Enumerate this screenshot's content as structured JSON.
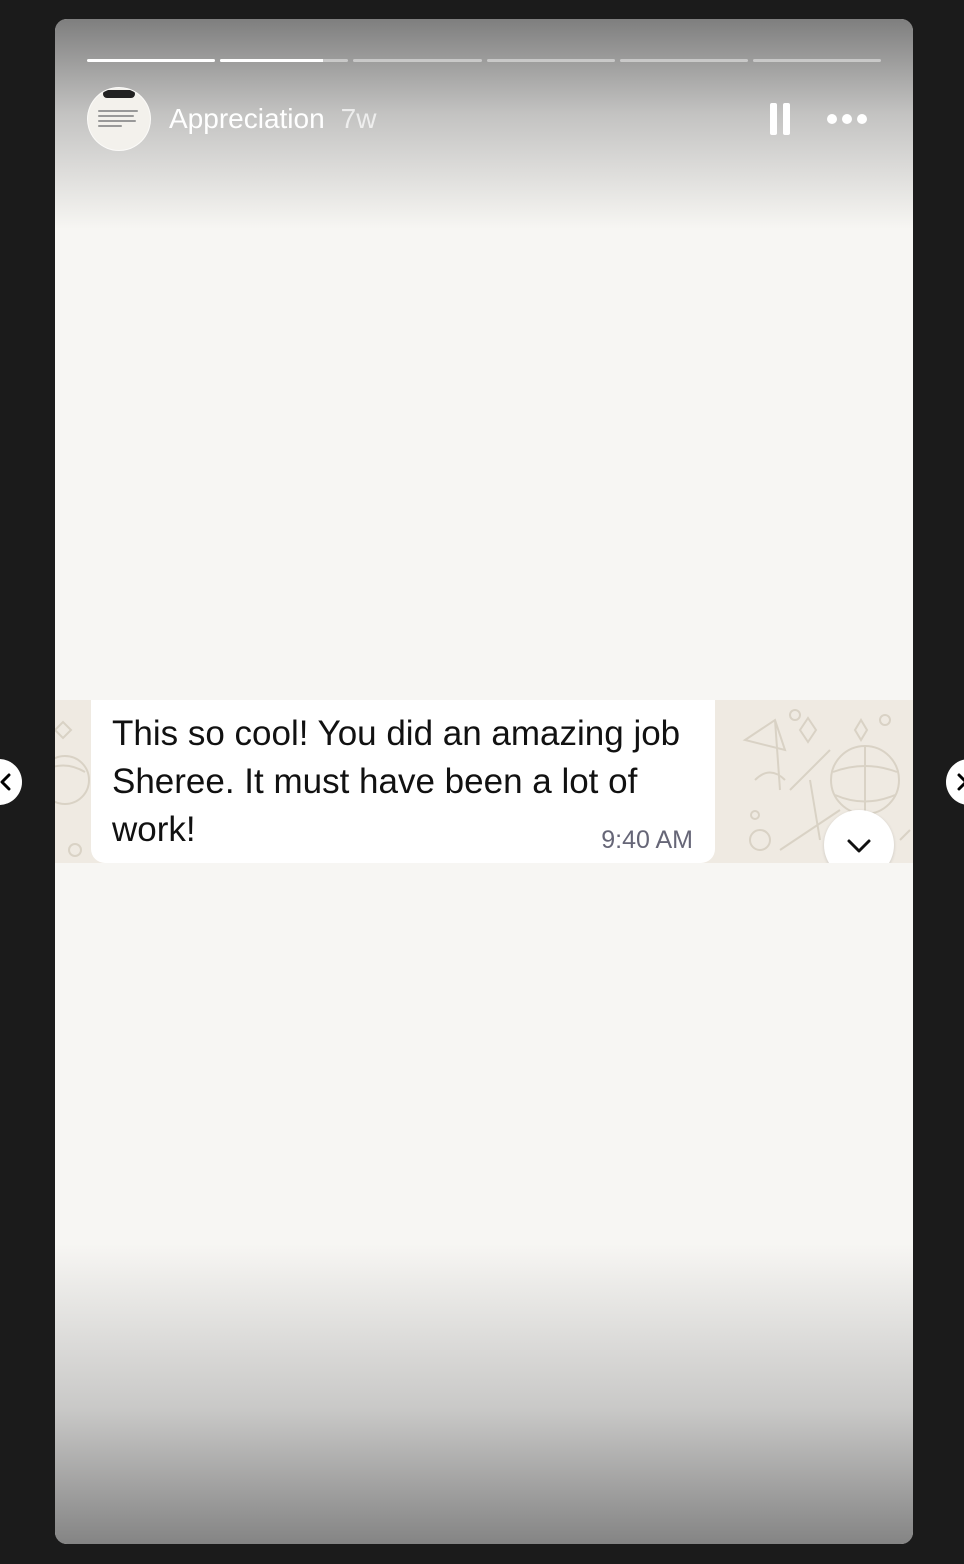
{
  "story": {
    "account_name": "Appreciation",
    "time_ago": "7w",
    "segments": [
      {
        "progress": 1.0
      },
      {
        "progress": 0.8
      },
      {
        "progress": 0
      },
      {
        "progress": 0
      },
      {
        "progress": 0
      },
      {
        "progress": 0
      }
    ],
    "controls": {
      "pause_icon": "pause-icon",
      "more_icon": "more-options-icon"
    }
  },
  "message": {
    "text": "This so cool! You did an amazing job Sheree. It must have been a lot of work!",
    "time": "9:40 AM",
    "scroll_icon": "chevron-down-icon"
  },
  "navigation": {
    "prev_icon": "chevron-left-icon",
    "next_icon": "chevron-right-icon"
  },
  "colors": {
    "viewer_background": "#1b1b1b",
    "story_background": "#f7f6f3",
    "chat_wallpaper": "#efeae2",
    "bubble": "#ffffff"
  }
}
